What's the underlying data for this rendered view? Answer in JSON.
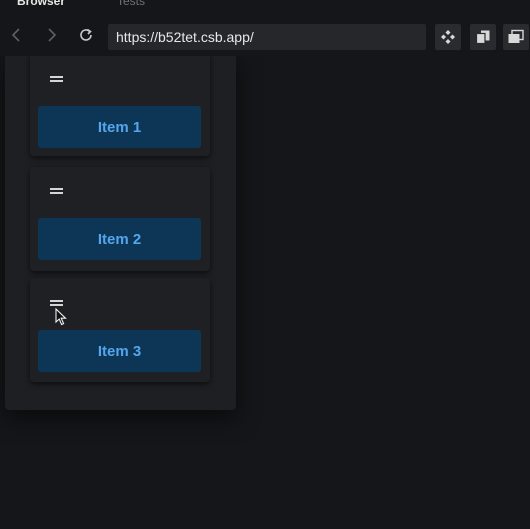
{
  "tabs": [
    {
      "label": "Browser",
      "active": true
    },
    {
      "label": "Tests",
      "active": false
    }
  ],
  "toolbar": {
    "url": "https://b52tet.csb.app/",
    "icons": [
      "chevron-left-icon",
      "chevron-right-icon",
      "reload-icon",
      "codesandbox-icon",
      "copy-icon",
      "window-icon"
    ]
  },
  "items": [
    {
      "label": "Item 1"
    },
    {
      "label": "Item 2"
    },
    {
      "label": "Item 3"
    }
  ],
  "colors": {
    "background": "#151619",
    "card": "#1f2024",
    "button_bg": "#0d3656",
    "button_text": "#54a6ec"
  }
}
